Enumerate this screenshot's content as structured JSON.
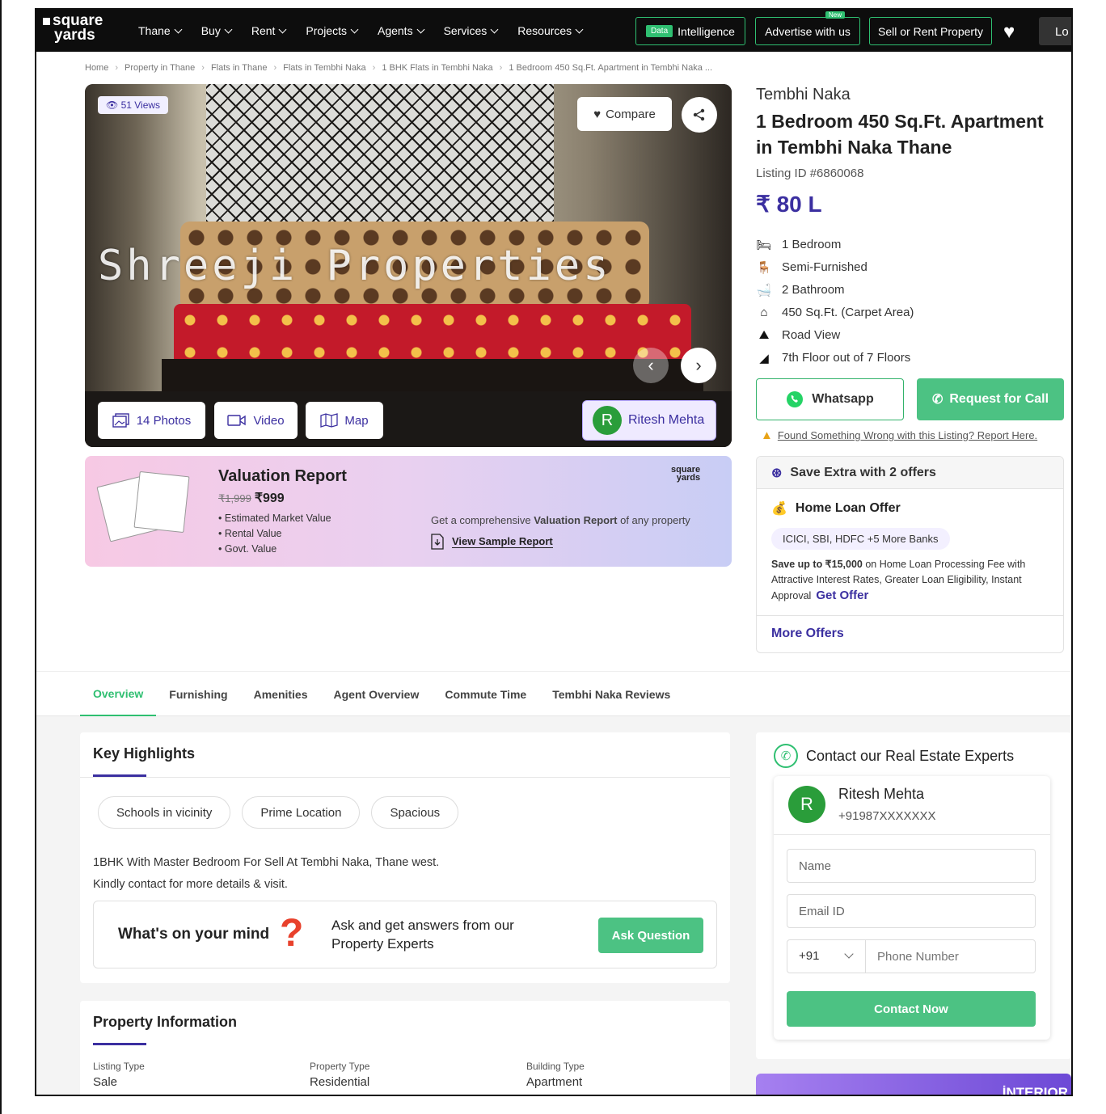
{
  "nav": {
    "logo_line1": "square",
    "logo_line2": "yards",
    "links": [
      "Thane",
      "Buy",
      "Rent",
      "Projects",
      "Agents",
      "Services",
      "Resources"
    ],
    "data_badge": "Data",
    "intelligence": "Intelligence",
    "advertise": "Advertise with us",
    "new_badge": "New",
    "sell_rent": "Sell or Rent Property",
    "login": "Lo"
  },
  "breadcrumb": [
    "Home",
    "Property in Thane",
    "Flats in Thane",
    "Flats in Tembhi Naka",
    "1 BHK Flats in Tembhi Naka",
    "1 Bedroom 450 Sq.Ft. Apartment in Tembhi Naka ..."
  ],
  "gallery": {
    "views": "51 Views",
    "compare": "Compare",
    "watermark": "Shreeji Properties",
    "photos": "14 Photos",
    "video": "Video",
    "map": "Map",
    "agent_initial": "R",
    "agent_name": "Ritesh Mehta"
  },
  "valuation": {
    "title": "Valuation Report",
    "old_price": "₹1,999",
    "price": "₹999",
    "items": [
      "Estimated Market Value",
      "Rental Value",
      "Govt. Value"
    ],
    "desc_prefix": "Get a comprehensive ",
    "desc_bold": "Valuation Report",
    "desc_suffix": " of any property",
    "sample": "View Sample Report",
    "logo_line1": "square",
    "logo_line2": "yards"
  },
  "listing": {
    "locality": "Tembhi Naka",
    "title": "1 Bedroom 450 Sq.Ft. Apartment in Tembhi Naka Thane",
    "listing_id": "Listing ID #6860068",
    "price": "₹ 80 L",
    "features": [
      {
        "icon": "bed-icon",
        "text": "1 Bedroom"
      },
      {
        "icon": "sofa-icon",
        "text": "Semi-Furnished"
      },
      {
        "icon": "bathtub-icon",
        "text": "2 Bathroom"
      },
      {
        "icon": "home-icon",
        "text": "450 Sq.Ft. (Carpet Area)"
      },
      {
        "icon": "landscape-icon",
        "text": "Road View"
      },
      {
        "icon": "stairs-icon",
        "text": "7th Floor out of 7 Floors"
      }
    ],
    "whatsapp": "Whatsapp",
    "request_call": "Request for Call",
    "report": "Found Something Wrong with this Listing? Report Here."
  },
  "offers": {
    "header": "Save Extra with 2 offers",
    "title": "Home Loan Offer",
    "banks": "ICICI, SBI, HDFC +5 More Banks",
    "desc_bold": "Save up to ₹15,000",
    "desc": " on Home Loan Processing Fee with Attractive Interest Rates, Greater Loan Eligibility, Instant Approval",
    "get_offer": "Get Offer",
    "more": "More Offers"
  },
  "tabs": [
    "Overview",
    "Furnishing",
    "Amenities",
    "Agent Overview",
    "Commute Time",
    "Tembhi Naka Reviews"
  ],
  "highlights": {
    "title": "Key Highlights",
    "chips": [
      "Schools in vicinity",
      "Prime Location",
      "Spacious"
    ],
    "desc_line1": "1BHK With Master Bedroom For Sell At Tembhi Naka, Thane west.",
    "desc_line2": "Kindly contact for more details & visit.",
    "ask_q": "What's on your mind",
    "ask_line1": "Ask and get answers from our",
    "ask_line2": "Property Experts",
    "ask_btn": "Ask Question"
  },
  "property_info": {
    "title": "Property Information",
    "cols": [
      {
        "label": "Listing Type",
        "value": "Sale"
      },
      {
        "label": "Property Type",
        "value": "Residential"
      },
      {
        "label": "Building Type",
        "value": "Apartment"
      }
    ]
  },
  "contact": {
    "title": "Contact our Real Estate Experts",
    "agent_initial": "R",
    "agent_name": "Ritesh Mehta",
    "agent_phone": "+91987XXXXXXX",
    "name_ph": "Name",
    "email_ph": "Email ID",
    "country_code": "+91",
    "phone_ph": "Phone Number",
    "button": "Contact Now"
  },
  "interior_banner": "İNTERIOR",
  "colors": {
    "brand": "#3b2fa0",
    "accent": "#4cc283",
    "nav_bg": "#0d0d0d"
  }
}
